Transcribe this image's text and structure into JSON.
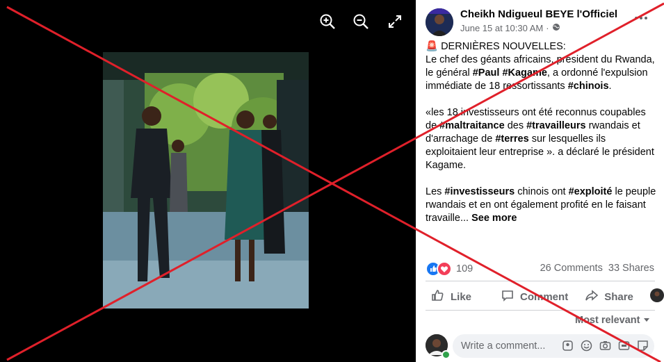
{
  "viewer": {
    "zoom_in_icon": "zoom-in-icon",
    "zoom_out_icon": "zoom-out-icon",
    "fullscreen_icon": "expand-icon"
  },
  "post": {
    "author": "Cheikh Ndigueul BEYE l'Officiel",
    "timestamp": "June 15 at 10:30 AM",
    "separator": "·",
    "audience_icon": "globe-icon",
    "more_icon": "more-options-icon",
    "headline": "🚨 DERNIÈRES NOUVELLES:",
    "para1_a": "Le chef des géants africains, président du Rwanda, le général ",
    "tag_paul": "#Paul",
    "para1_b": " ",
    "tag_kagame": "#Kagame",
    "para1_c": ", a ordonné l'expulsion immédiate de 18 ressortissants ",
    "tag_chinois": "#chinois",
    "para1_d": ".",
    "para2_a": "«les 18 investisseurs ont été reconnus coupables de ",
    "tag_maltraitance": "#maltraitance",
    "para2_b": " des ",
    "tag_travailleurs": "#travailleurs",
    "para2_c": " rwandais et d'arrachage de ",
    "tag_terres": "#terres",
    "para2_d": " sur lesquelles ils exploitaient leur entreprise ». a déclaré le président Kagame.",
    "para3_a": "Les ",
    "tag_investisseurs": "#investisseurs",
    "para3_b": " chinois ont ",
    "tag_exploite": "#exploité",
    "para3_c": " le peuple rwandais et en ont également profité en le faisant travaille... ",
    "see_more": "See more"
  },
  "stats": {
    "reactions": "109",
    "comments": "26 Comments",
    "shares": "33 Shares"
  },
  "actions": {
    "like": "Like",
    "comment": "Comment",
    "share": "Share"
  },
  "comments": {
    "sort_label": "Most relevant",
    "placeholder": "Write a comment..."
  },
  "colors": {
    "like_blue": "#1877f2",
    "love_red": "#f33e58",
    "cross_red": "#e0202a"
  }
}
